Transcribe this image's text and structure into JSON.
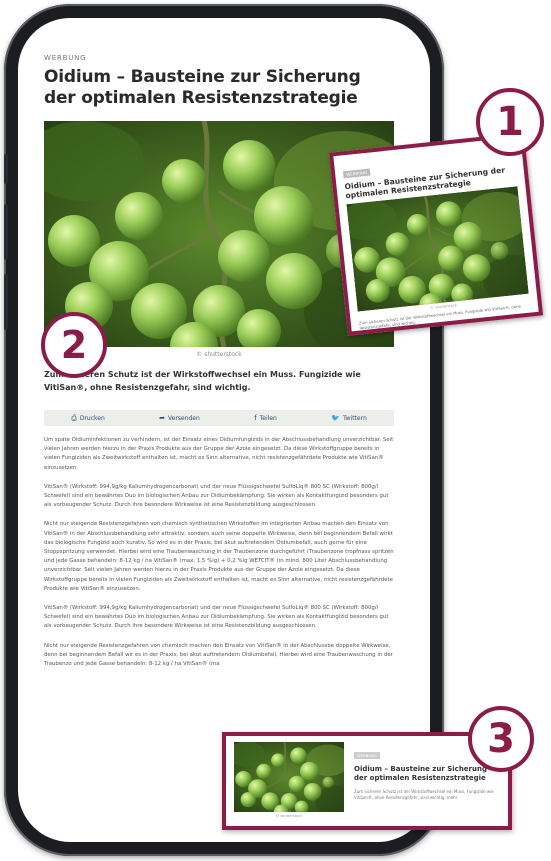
{
  "article": {
    "kicker": "WERBUNG",
    "title": "Oidium – Bausteine zur Sicherung der optimalen Resistenzstrategie",
    "image_credit": "© shutterstock",
    "lead": "Zum sicheren Schutz ist der Wirkstoffwechsel ein Muss. Fungizide wie VitiSan®, ohne Resistenzgefahr, sind wichtig.",
    "share": {
      "print": "Drucken",
      "send": "Versenden",
      "facebook": "Teilen",
      "twitter": "Twittern"
    },
    "paragraphs": [
      "Um späte Oidiuminfektionen zu verhindern, ist der Einsatz eines Oidiumfungizids in der Abschlussbehandlung unverzichtbar. Seit vielen Jahren werden hierzu in der Praxis Produkte aus der Gruppe der Azole eingesetzt. Da diese Wirkstoffgruppe bereits in vielen Fungiziden als Zweitwirkstoff enthalten ist, macht es Sinn alternative, nicht resistenzgefährdete Produkte wie VitiSan® einzusetzen.",
      "VitiSan® (Wirkstoff: 994,9g/kg Kaliumhydrogencarbonat) und der neue Flüssigschwefel SulfoLiq® 800 SC (Wirkstoff: 800g/l Schwefel) sind ein bewährtes Duo im biologischen Anbau zur Oidiumbekämpfung. Sie wirken als Kontaktfungizid besonders gut als vorbeugender Schutz. Durch ihre besondere Wirkweise ist eine Resistenzbildung ausgeschlossen.",
      "Nicht nur steigende Resistenzgefahren von chemisch synthetischen Wirkstoffen im integrierten Anbau machen den Einsatz von VitiSan® in der Abschlussbehandlung sehr attraktiv, sondern auch seine doppelte Wirkweise, denn bei beginnendem Befall wirkt das biologische Fungizid auch kurativ. So wird es in der Praxis, bei akut auftretendem Oidiumbefall, auch gerne für eine Stoppspritzung verwendet. Hierbei wird eine Traubenwaschung in der Traubenzone durchgeführt (Traubenzone tropfnass spritzen und jede Gasse behandeln: 8-12 kg / ha VitiSan® (max. 1,5 %ig) + 0,2 %ig WETCIT® (in mind. 800 Liter Abschlussbehandlung unverzichtbar. Seit vielen Jahren werden hierzu in der Praxis Produkte aus der Gruppe der Azole eingesetzt. Da diese Wirkstoffgruppe bereits in vielen Fungiziden als Zweitwirkstoff enthalten ist, macht es Sinn alternative, nicht resistenzgefährdete Produkte wie VitiSan® einzusetzen.",
      "VitiSan® (Wirkstoff: 994,9g/kg Kaliumhydrogencarbonat) und der neue Flüssigschwefel SulfoLiq® 800 SC (Wirkstoff: 800g/l Schwefel) sind ein bewährtes Duo im biologischen Anbau zur Oidiumbekämpfung. Sie wirken als Kontaktfungizid besonders gut als vorbeugender Schutz. Durch ihre besondere Wirkweise ist eine Resistenzbildung ausgeschlossen.",
      "Nicht nur steigende Resistenzgefahren von chemisch machen den Einsatz von VitiSan® in der Abschlussbe doppelte Wirkweise, denn bei beginnendem Befall wir es in der Praxis, bei akut auftretendem Oidiumbefall, Hierbei wird eine Traubenwaschung in der Traubenzo und jede Gasse behandeln: 8-12 kg / ha VitiSan® (ma"
    ]
  },
  "card1": {
    "kicker": "WERBUNG",
    "title": "Oidium – Bausteine zur Sicherung der optimalen Resistenzstrategie",
    "credit": "© shutterstock",
    "lead": "Zum sicheren Schutz ist der Wirkstoffwechsel ein Muss. Fungizide wie VitiSan®, ohne Resistenzgefahr, sind wichtig."
  },
  "card3": {
    "kicker": "WERBUNG",
    "title": "Oidium – Bausteine zur Sicherung der optimalen Resistenzstrategie",
    "credit": "© shutterstock",
    "lead": "Zum sicheren Schutz ist der Wirkstoffwechsel ein Muss. Fungizide wie VitiSan®, ohne Resistenzgefahr, sind wichtig. mehr"
  },
  "badges": {
    "one": "1",
    "two": "2",
    "three": "3"
  },
  "colors": {
    "accent": "#8b1b47",
    "grape": "#9ccf5a",
    "leaf": "#2f4a1c"
  },
  "icons": {
    "print": "printer-icon",
    "send": "share-arrow-icon",
    "facebook": "facebook-icon",
    "twitter": "twitter-icon"
  }
}
